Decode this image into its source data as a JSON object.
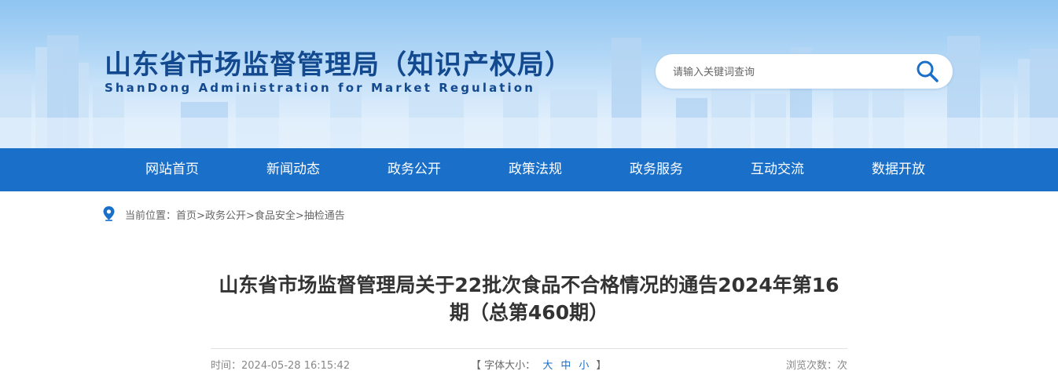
{
  "header": {
    "title": "山东省市场监督管理局（知识产权局）",
    "subtitle": "ShanDong Administration for Market Regulation"
  },
  "search": {
    "placeholder": "请输入关键词查询",
    "icon": "search-icon"
  },
  "nav": {
    "items": [
      {
        "label": "网站首页"
      },
      {
        "label": "新闻动态"
      },
      {
        "label": "政务公开"
      },
      {
        "label": "政策法规"
      },
      {
        "label": "政务服务"
      },
      {
        "label": "互动交流"
      },
      {
        "label": "数据开放"
      }
    ]
  },
  "breadcrumb": {
    "prefix": "当前位置：",
    "items": [
      "首页",
      "政务公开",
      "食品安全",
      "抽检通告"
    ],
    "separator": ">",
    "icon": "location-pin-icon"
  },
  "article": {
    "title": "山东省市场监督管理局关于22批次食品不合格情况的通告2024年第16期（总第460期）",
    "time_label": "时间：",
    "time_value": "2024-05-28 16:15:42",
    "font_size_label": "字体大小：",
    "font_large": "大",
    "font_medium": "中",
    "font_small": "小",
    "bracket_open": "【",
    "bracket_close": "】",
    "views_label": "浏览次数：",
    "views_suffix": "次"
  },
  "colors": {
    "brand_blue": "#1a6fc9",
    "title_blue": "#13498f"
  }
}
